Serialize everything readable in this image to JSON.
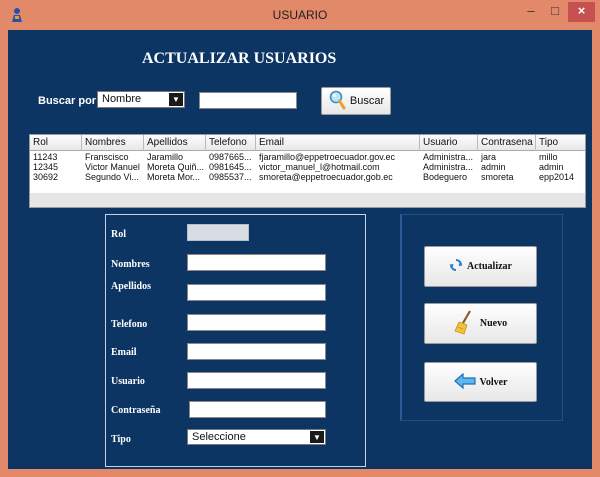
{
  "window": {
    "title": "USUARIO",
    "minimize": "–",
    "maximize": "□",
    "close": "×"
  },
  "heading": "ACTUALIZAR USUARIOS",
  "search": {
    "label": "Buscar por:",
    "combo_value": "Nombre",
    "input_value": "",
    "button_label": "Buscar"
  },
  "table": {
    "columns": [
      "Rol",
      "Nombres",
      "Apellidos",
      "Telefono",
      "Email",
      "Usuario",
      "Contrasena",
      "Tipo"
    ],
    "rows": [
      [
        "11243",
        "Franscisco",
        "Jaramillo",
        "0987665...",
        "fjaramillo@eppetroecuador.gov.ec",
        "Administra...",
        "jara",
        "millo"
      ],
      [
        "12345",
        "Victor Manuel",
        "Moreta Quiñ...",
        "0981645...",
        "victor_manuel_l@hotmail.com",
        "Administra...",
        "admin",
        "admin"
      ],
      [
        "30692",
        "Segundo Vi...",
        "Moreta Mor...",
        "0985537...",
        "smoreta@eppetroecuador,gob.ec",
        "Bodeguero",
        "smoreta",
        "epp2014"
      ]
    ]
  },
  "form": {
    "rol_label": "Rol",
    "nombres_label": "Nombres",
    "apellidos_label": "Apellidos",
    "telefono_label": "Telefono",
    "email_label": "Email",
    "usuario_label": "Usuario",
    "contrasena_label": "Contraseña",
    "tipo_label": "Tipo",
    "tipo_value": "Seleccione"
  },
  "actions": {
    "actualizar": "Actualizar",
    "nuevo": "Nuevo",
    "volver": "Volver"
  },
  "colors": {
    "background": "#0c3564",
    "window_frame": "#e2896a",
    "close_button": "#c75050"
  },
  "icons": [
    "java-app-icon",
    "magnifier-icon",
    "refresh-icon",
    "broom-icon",
    "back-arrow-icon",
    "chevron-down-icon"
  ]
}
